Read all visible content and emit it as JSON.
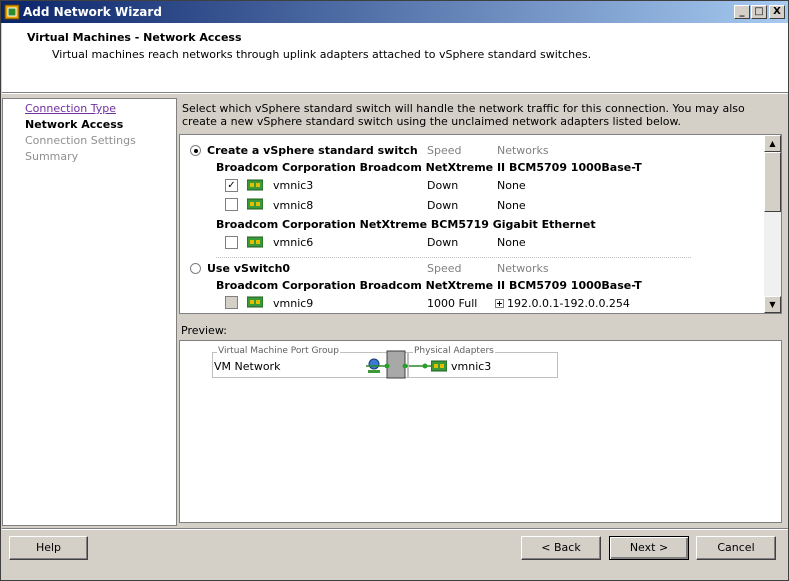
{
  "window": {
    "title": "Add Network Wizard"
  },
  "header": {
    "title": "Virtual Machines - Network Access",
    "subtitle": "Virtual machines reach networks through uplink adapters attached to vSphere standard switches."
  },
  "nav": {
    "items": [
      {
        "label": "Connection Type",
        "state": "link"
      },
      {
        "label": "Network Access",
        "state": "current"
      },
      {
        "label": "Connection Settings",
        "state": "disabled"
      },
      {
        "label": "Summary",
        "state": "disabled"
      }
    ]
  },
  "content": {
    "description": "Select which vSphere standard switch will handle the network traffic for this connection. You may also create a new vSphere standard switch using the unclaimed network adapters listed below.",
    "option_create": {
      "label": "Create a vSphere standard switch",
      "selected": true,
      "speed_header": "Speed",
      "networks_header": "Networks",
      "groups": [
        {
          "name": "Broadcom Corporation Broadcom NetXtreme II BCM5709 1000Base-T",
          "adapters": [
            {
              "name": "vmnic3",
              "checked": true,
              "speed": "Down",
              "networks": "None"
            },
            {
              "name": "vmnic8",
              "checked": false,
              "speed": "Down",
              "networks": "None"
            }
          ]
        },
        {
          "name": "Broadcom Corporation NetXtreme BCM5719 Gigabit Ethernet",
          "adapters": [
            {
              "name": "vmnic6",
              "checked": false,
              "speed": "Down",
              "networks": "None"
            }
          ]
        }
      ]
    },
    "option_use": {
      "label": "Use vSwitch0",
      "selected": false,
      "speed_header": "Speed",
      "networks_header": "Networks",
      "groups": [
        {
          "name": "Broadcom Corporation Broadcom NetXtreme II BCM5709 1000Base-T",
          "adapters": [
            {
              "name": "vmnic9",
              "checked": false,
              "speed": "1000 Full",
              "networks": "192.0.0.1-192.0.0.254"
            }
          ]
        }
      ]
    },
    "preview": {
      "label": "Preview:",
      "port_group_caption": "Virtual Machine Port Group",
      "port_group_name": "VM Network",
      "adapters_caption": "Physical Adapters",
      "adapter_name": "vmnic3"
    }
  },
  "buttons": {
    "help": "Help",
    "back": "< Back",
    "next": "Next >",
    "cancel": "Cancel"
  },
  "window_controls": {
    "minimize": "_",
    "maximize": "□",
    "close": "X"
  }
}
